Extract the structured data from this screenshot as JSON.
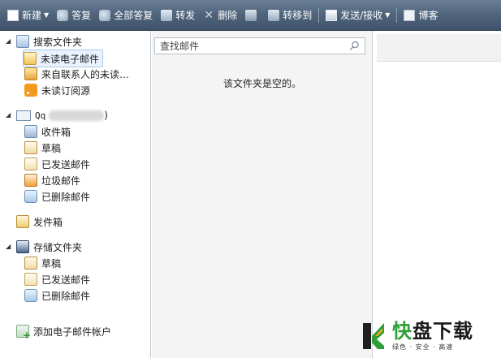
{
  "toolbar": {
    "new": "新建",
    "reply": "答复",
    "reply_all": "全部答复",
    "forward": "转发",
    "delete": "删除",
    "move_to": "转移到",
    "send_receive": "发送/接收",
    "blog": "博客"
  },
  "folders": {
    "search_folders": "搜索文件夹",
    "unread_email": "未读电子邮件",
    "unread_from_contacts": "来自联系人的未读…",
    "unread_feeds": "未读订阅源",
    "account_prefix": "Qq",
    "account_suffix": ")",
    "inbox": "收件箱",
    "drafts": "草稿",
    "sent": "已发送邮件",
    "junk": "垃圾邮件",
    "deleted": "已删除邮件",
    "outbox": "发件箱",
    "storage_folders": "存储文件夹",
    "storage_drafts": "草稿",
    "storage_sent": "已发送邮件",
    "storage_deleted": "已删除邮件",
    "add_account": "添加电子邮件帐户"
  },
  "message_list": {
    "search_placeholder": "查找邮件",
    "empty_text": "该文件夹是空的。"
  },
  "watermark": {
    "brand_char": "快",
    "brand_rest": "盘下载",
    "slogan": "绿色 · 安全 · 高速"
  }
}
